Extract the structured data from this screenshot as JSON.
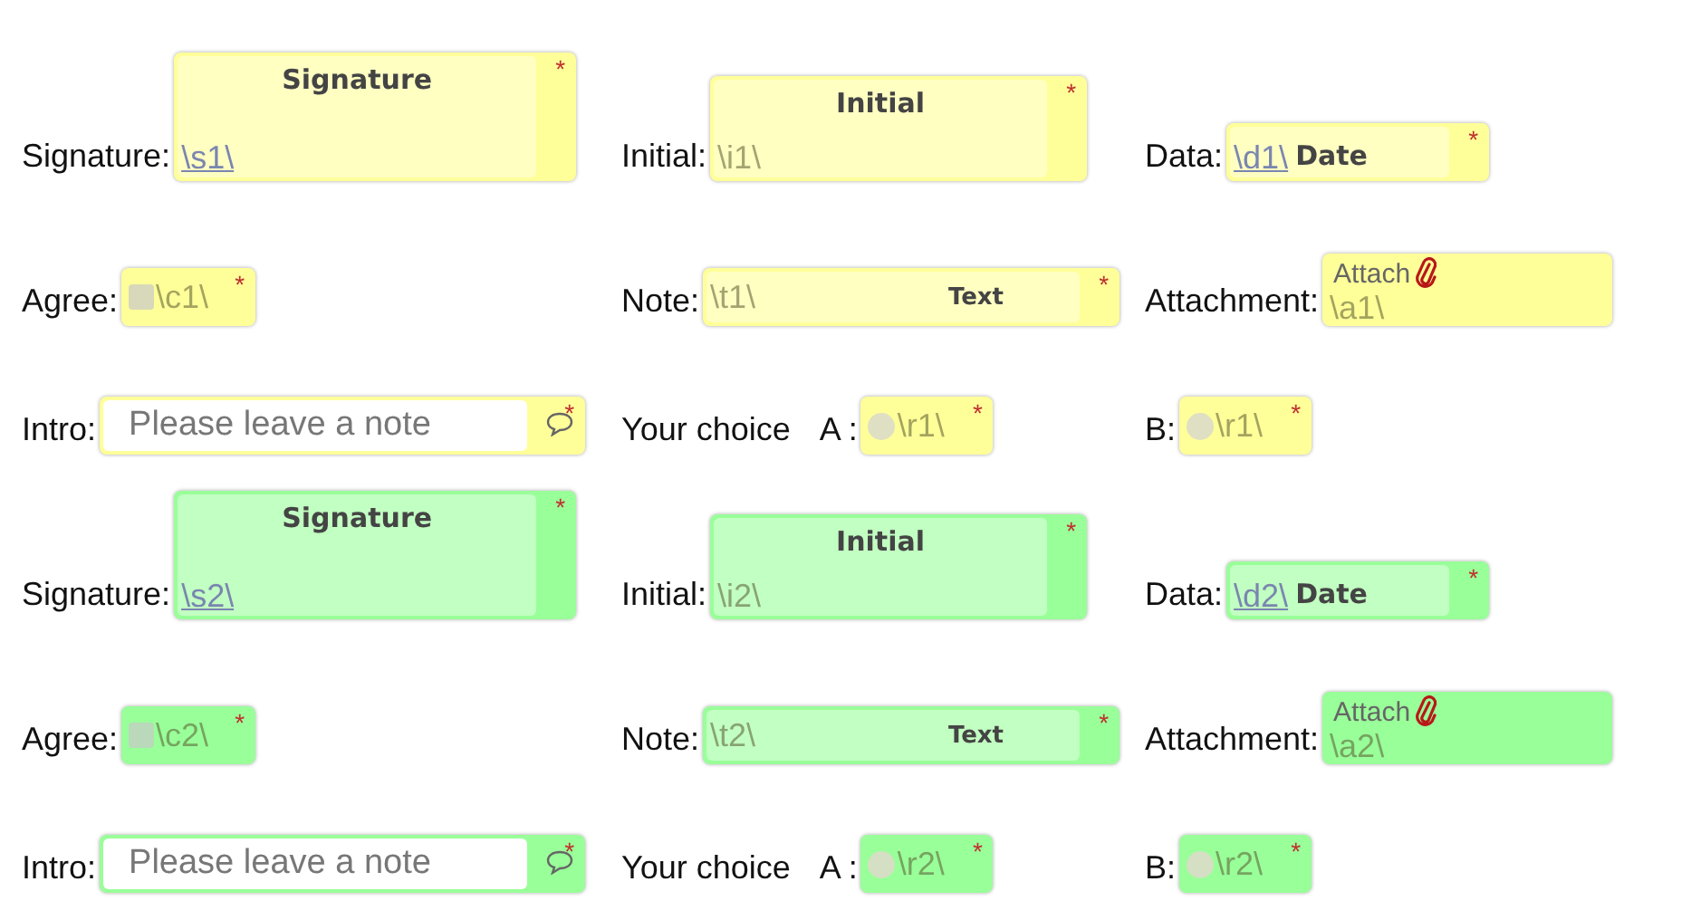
{
  "recipients": [
    {
      "color": "#ffff99",
      "rows": [
        {
          "columns": [
            [
              {
                "label": "Signature:",
                "field": {
                  "kind": "signature",
                  "anchor": "\\s1\\",
                  "title": "Signature",
                  "mark": "*"
                }
              }
            ],
            [
              {
                "label": "Initial:",
                "field": {
                  "kind": "initial",
                  "anchor": "\\i1\\",
                  "title": "Initial",
                  "mark": "*"
                }
              }
            ],
            [
              {
                "label": "Data:",
                "field": {
                  "kind": "date",
                  "anchor": "\\d1\\",
                  "title": "Date",
                  "mark": "*"
                }
              }
            ]
          ]
        },
        {
          "columns": [
            [
              {
                "label": "Agree:",
                "field": {
                  "kind": "checkbox",
                  "anchor": "\\c1\\",
                  "checked": false,
                  "mark": "*"
                }
              }
            ],
            [
              {
                "label": "Note:",
                "field": {
                  "kind": "text",
                  "anchor": "\\t1\\",
                  "title": "Text",
                  "mark": "*"
                }
              }
            ],
            [
              {
                "label": "Attachment:",
                "field": {
                  "kind": "attachment",
                  "anchor": "\\a1\\",
                  "title": "Attach"
                }
              }
            ]
          ]
        },
        {
          "columns": [
            [
              {
                "label": "Intro:",
                "field": {
                  "kind": "comment",
                  "placeholder": "Please leave a note",
                  "mark": "*"
                }
              }
            ],
            [
              {
                "label": "Your choice"
              },
              {
                "label": "A :",
                "field": {
                  "kind": "radio",
                  "anchor": "\\r1\\",
                  "selected": false,
                  "mark": "*"
                }
              }
            ],
            [
              {
                "label": "B:",
                "field": {
                  "kind": "radio",
                  "anchor": "\\r1\\",
                  "selected": false,
                  "mark": "*"
                }
              }
            ]
          ]
        }
      ]
    },
    {
      "color": "#99ff99",
      "rows": [
        {
          "columns": [
            [
              {
                "label": "Signature:",
                "field": {
                  "kind": "signature",
                  "anchor": "\\s2\\",
                  "title": "Signature",
                  "mark": "*"
                }
              }
            ],
            [
              {
                "label": "Initial:",
                "field": {
                  "kind": "initial",
                  "anchor": "\\i2\\",
                  "title": "Initial",
                  "mark": "*"
                }
              }
            ],
            [
              {
                "label": "Data:",
                "field": {
                  "kind": "date",
                  "anchor": "\\d2\\",
                  "title": "Date",
                  "mark": "*"
                }
              }
            ]
          ]
        },
        {
          "columns": [
            [
              {
                "label": "Agree:",
                "field": {
                  "kind": "checkbox",
                  "anchor": "\\c2\\",
                  "checked": false,
                  "mark": "*"
                }
              }
            ],
            [
              {
                "label": "Note:",
                "field": {
                  "kind": "text",
                  "anchor": "\\t2\\",
                  "title": "Text",
                  "mark": "*"
                }
              }
            ],
            [
              {
                "label": "Attachment:",
                "field": {
                  "kind": "attachment",
                  "anchor": "\\a2\\",
                  "title": "Attach"
                }
              }
            ]
          ]
        },
        {
          "columns": [
            [
              {
                "label": "Intro:",
                "field": {
                  "kind": "comment",
                  "placeholder": "Please leave a note",
                  "mark": "*"
                }
              }
            ],
            [
              {
                "label": "Your choice"
              },
              {
                "label": "A :",
                "field": {
                  "kind": "radio",
                  "anchor": "\\r2\\",
                  "selected": false,
                  "mark": "*"
                }
              }
            ],
            [
              {
                "label": "B:",
                "field": {
                  "kind": "radio",
                  "anchor": "\\r2\\",
                  "selected": false,
                  "mark": "*"
                }
              }
            ]
          ]
        }
      ]
    }
  ]
}
